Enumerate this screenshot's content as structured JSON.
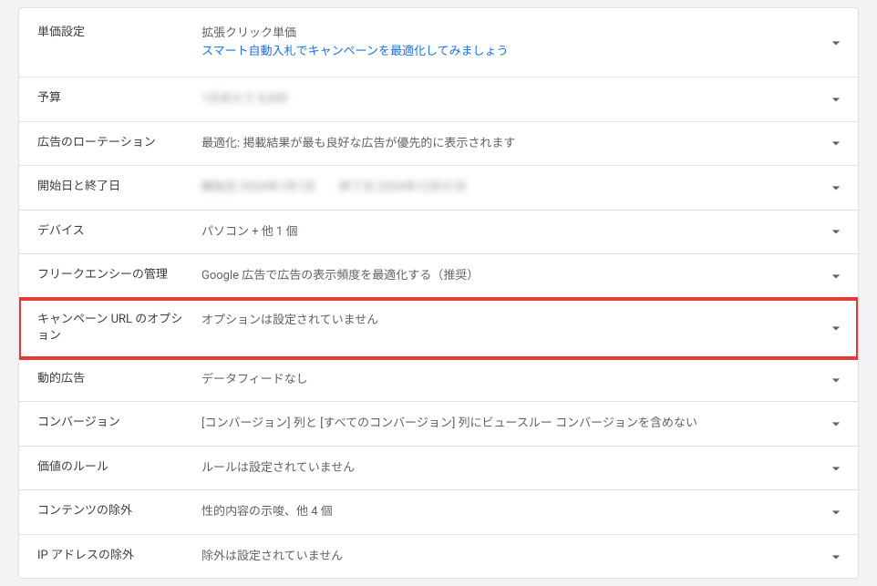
{
  "rows": [
    {
      "id": "bidding",
      "label": "単価設定",
      "value_line1": "拡張クリック単価",
      "link_line": "スマート自動入札でキャンペーンを最適化してみましょう",
      "tall": true
    },
    {
      "id": "budget",
      "label": "予算",
      "value_blurred": "1日あたり 8,000"
    },
    {
      "id": "ad-rotation",
      "label": "広告のローテーション",
      "value": "最適化: 掲載結果が最も良好な広告が優先的に表示されます"
    },
    {
      "id": "start-end-dates",
      "label": "開始日と終了日",
      "value_blurred": "開始日 2024年1月1日　　終了日 2024年12月31日"
    },
    {
      "id": "devices",
      "label": "デバイス",
      "value": "パソコン + 他 1 個"
    },
    {
      "id": "frequency-management",
      "label": "フリークエンシーの管理",
      "value": "Google 広告で広告の表示頻度を最適化する（推奨）"
    },
    {
      "id": "campaign-url-options",
      "label": "キャンペーン URL のオプション",
      "value": "オプションは設定されていません",
      "highlighted": true
    },
    {
      "id": "dynamic-ads",
      "label": "動的広告",
      "value": "データフィードなし"
    },
    {
      "id": "conversions",
      "label": "コンバージョン",
      "value": "[コンバージョン] 列と [すべてのコンバージョン] 列にビュースルー コンバージョンを含めない"
    },
    {
      "id": "value-rules",
      "label": "価値のルール",
      "value": "ルールは設定されていません"
    },
    {
      "id": "content-exclusions",
      "label": "コンテンツの除外",
      "value": "性的内容の示唆、他 4 個"
    },
    {
      "id": "ip-exclusions",
      "label": "IP アドレスの除外",
      "value": "除外は設定されていません"
    }
  ]
}
